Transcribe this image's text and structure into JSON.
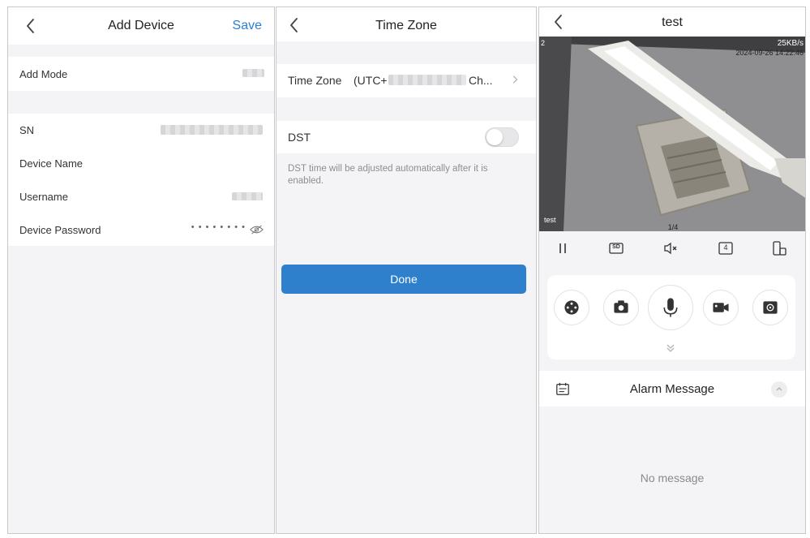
{
  "add_device": {
    "title": "Add Device",
    "save_label": "Save",
    "add_mode_label": "Add Mode",
    "sn_label": "SN",
    "device_name_label": "Device Name",
    "username_label": "Username",
    "password_label": "Device Password",
    "password_mask": "• • • • • • • •"
  },
  "time_zone": {
    "title": "Time Zone",
    "tz_label": "Time Zone",
    "tz_value_prefix": "(UTC+",
    "tz_value_suffix": "Ch...",
    "dst_label": "DST",
    "dst_enabled": false,
    "dst_note": "DST time will be adjusted automatically after it is enabled.",
    "done_label": "Done"
  },
  "live_view": {
    "title": "test",
    "stream_rate": "25KB/s",
    "timestamp": "2024-09-26 14:22:46",
    "channel_corner": "2",
    "channel_name": "test",
    "page_indicator": "1/4",
    "stream_badge": "SD",
    "split_badge": "4",
    "alarm_title": "Alarm Message",
    "empty_text": "No message"
  },
  "colors": {
    "accent": "#2b7fd0",
    "button": "#2f80cc",
    "background": "#f4f4f6"
  }
}
